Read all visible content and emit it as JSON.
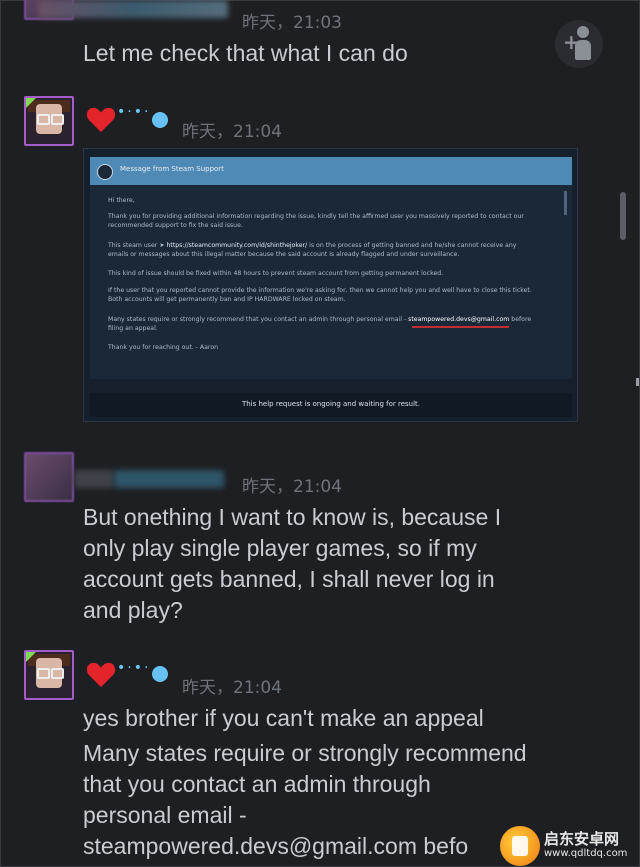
{
  "messages": [
    {
      "sender": "user",
      "timestamp": "昨天，21:03",
      "lines": [
        "Let me check that what I can do"
      ]
    },
    {
      "sender": "support",
      "timestamp": "昨天，21:04",
      "attachment": {
        "title": "Message from Steam Support",
        "greeting": "Hi there,",
        "p1": "Thank you for providing additional information regarding the issue, kindly tell the affirmed user you massively reported to contact our recommended support to fix the said issue.",
        "p2_prefix": "This steam user ➤ ",
        "p2_link": "https://steamcommunity.com/id/shinthejoker/",
        "p2_suffix": " is on the process of getting banned and he/she cannot receive any emails or messages about this illegal matter because the said account is already flagged and under surveillance.",
        "p3": "This kind of issue should be fixed within 48 hours to prevent steam account from getting permanent locked.",
        "p4": "If the user that you reported cannot provide the information we're asking for, then we cannot help you and well have to close this ticket. Both accounts will get permanently ban and IP HARDWARE locked on steam.",
        "p5_prefix": "Many states require or strongly recommend that you contact an admin through personal email - ",
        "p5_email": "steampowered.devs@gmail.com",
        "p5_suffix": " before filing an appeal.",
        "p6": "Thank you for reaching out. - Aaron",
        "footer": "This help request is ongoing and waiting for result."
      }
    },
    {
      "sender": "user",
      "timestamp": "昨天，21:04",
      "lines": [
        "But onething I want to know is, because I",
        "only play single player games, so if my",
        "account gets banned, I shall never log in",
        "and play?"
      ]
    },
    {
      "sender": "support",
      "timestamp": "昨天，21:04",
      "lines": [
        "yes brother if you can't make an appeal",
        "Many states require or strongly recommend",
        "that you contact an admin through",
        "personal email -",
        "steampowered.devs@gmail.com befo"
      ]
    }
  ],
  "watermark": {
    "name": "启东安卓网",
    "url": "www.qdltdq.com"
  },
  "colors": {
    "background": "#1e1f23",
    "heart": "#e3242b",
    "accent_blue": "#67c1f5",
    "steam_bar": "#4f89b5",
    "underline": "#c42d2d"
  }
}
